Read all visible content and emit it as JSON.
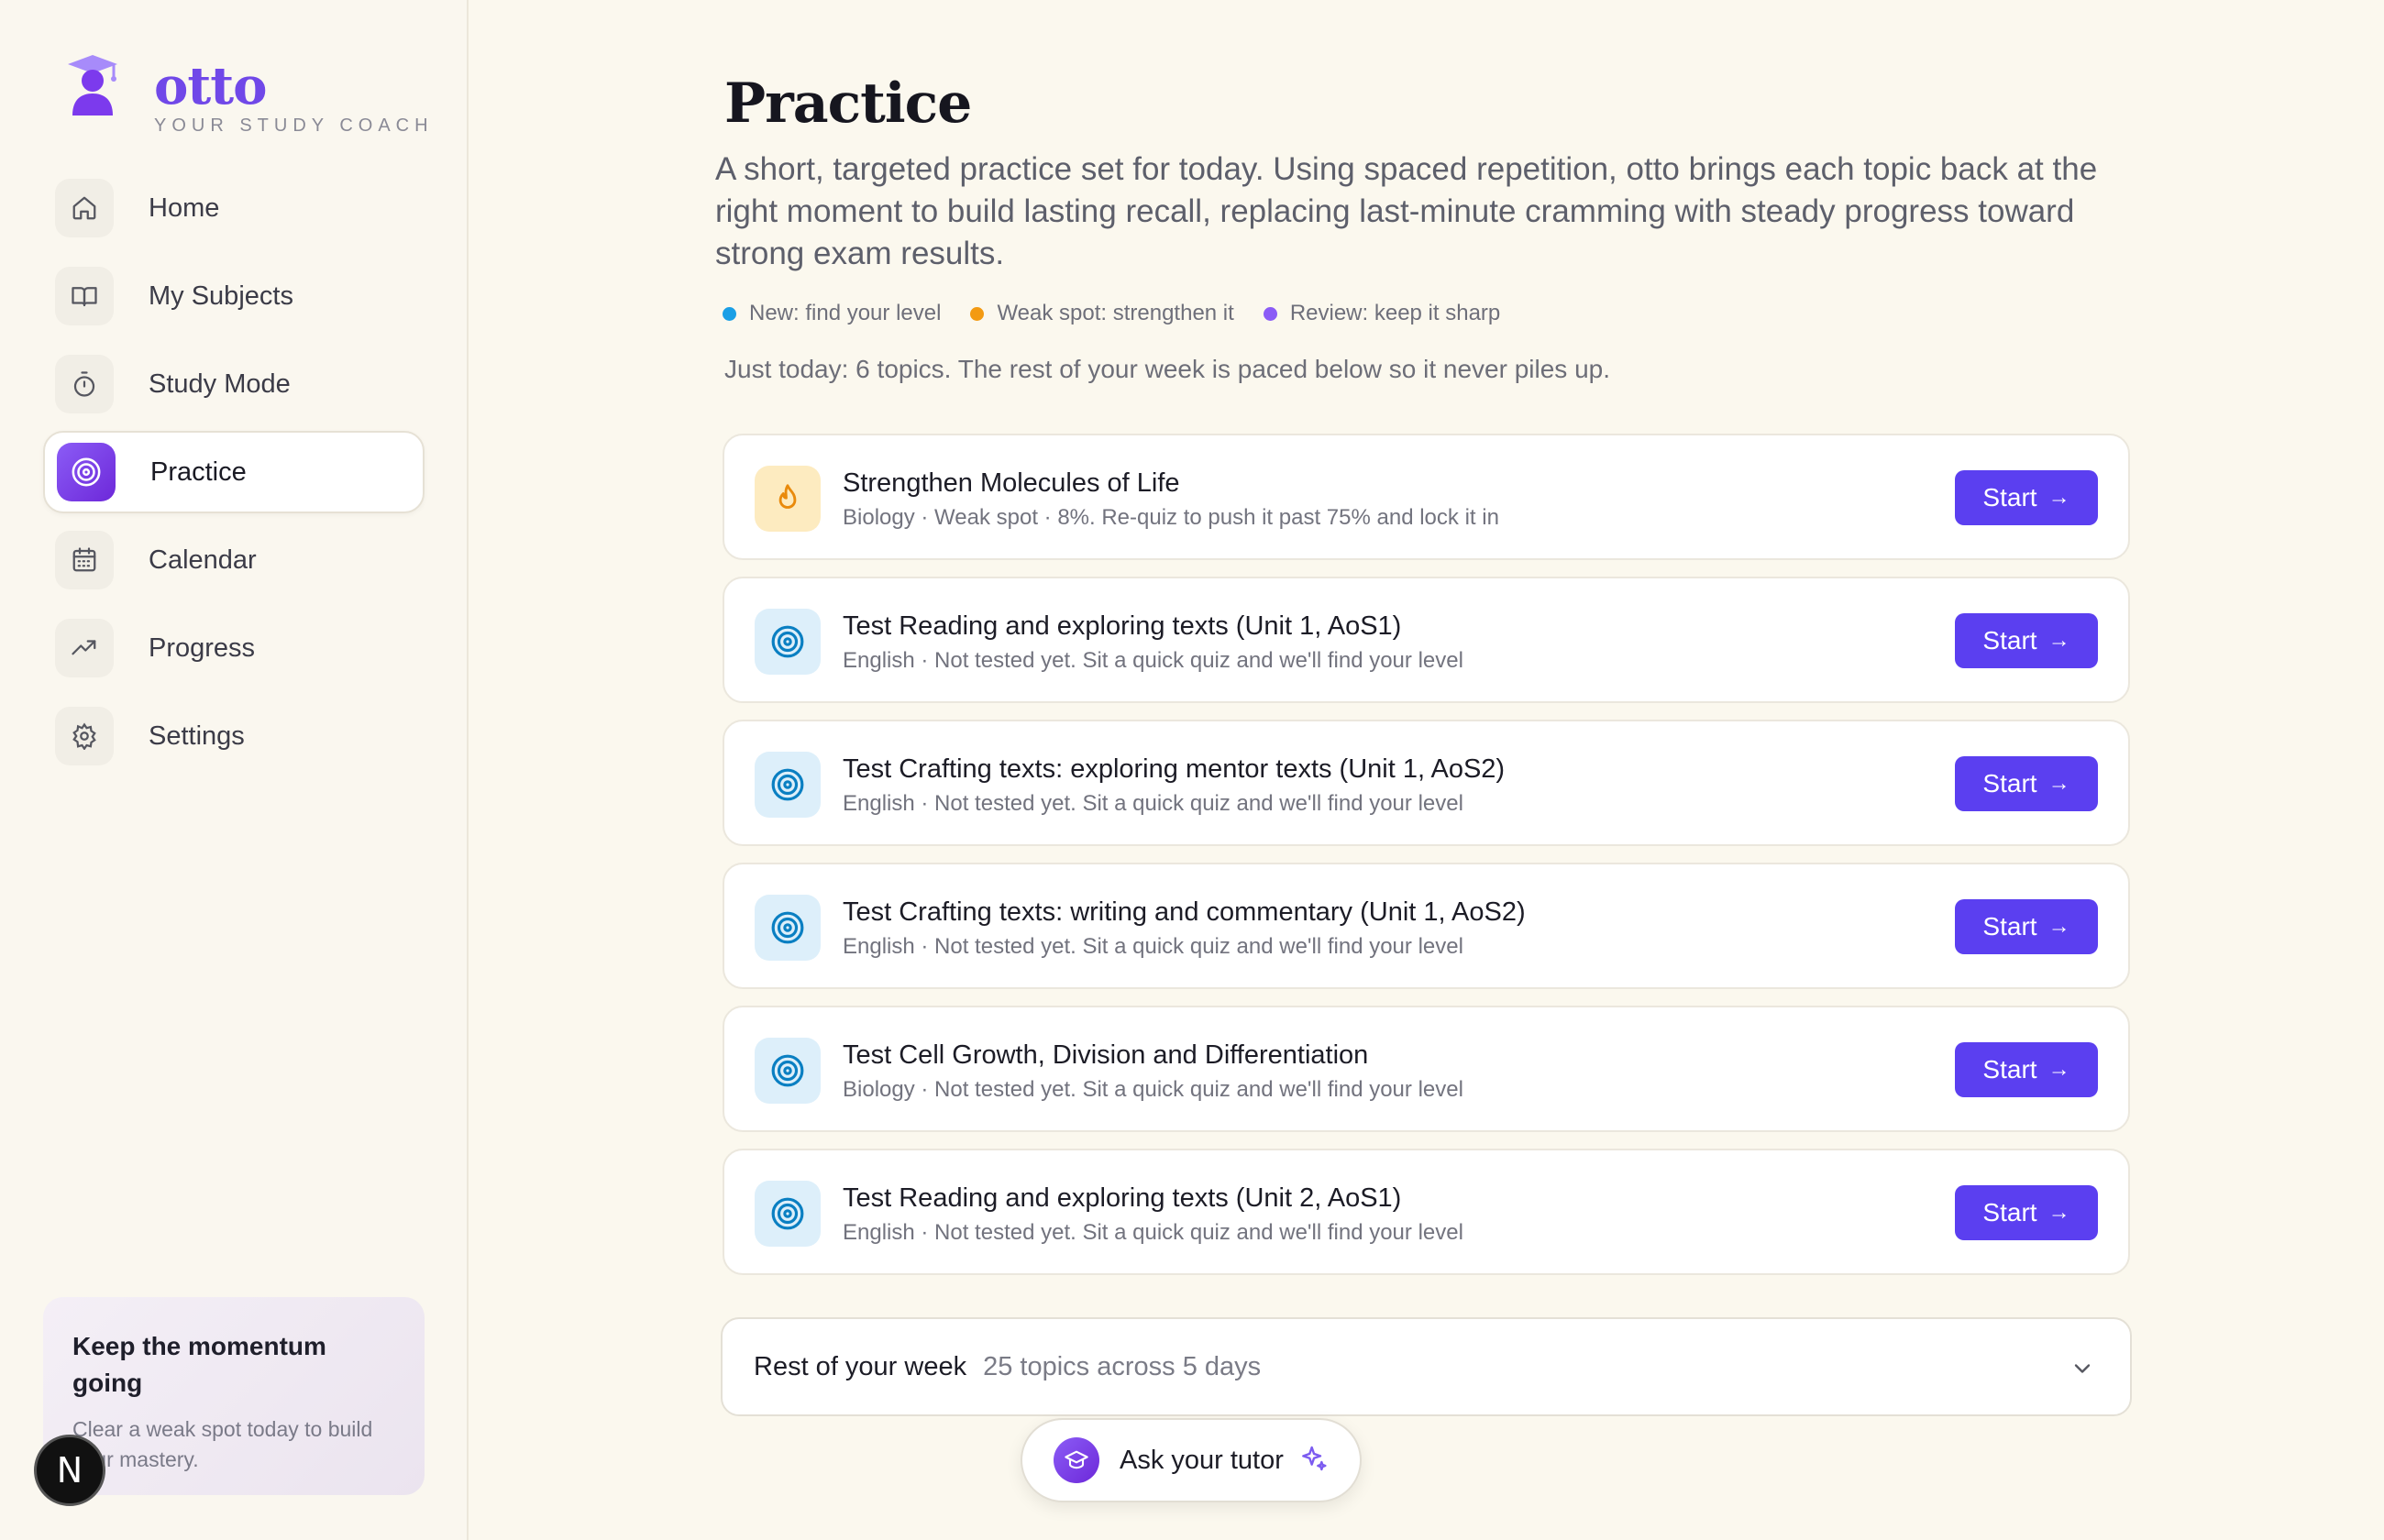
{
  "brand": {
    "name": "otto",
    "tagline": "YOUR STUDY COACH"
  },
  "nav": {
    "items": [
      {
        "label": "Home",
        "icon": "home-icon"
      },
      {
        "label": "My Subjects",
        "icon": "book-icon"
      },
      {
        "label": "Study Mode",
        "icon": "timer-icon"
      },
      {
        "label": "Practice",
        "icon": "target-icon",
        "active": true
      },
      {
        "label": "Calendar",
        "icon": "calendar-icon"
      },
      {
        "label": "Progress",
        "icon": "trend-icon"
      },
      {
        "label": "Settings",
        "icon": "gear-icon"
      }
    ]
  },
  "momentum": {
    "title": "Keep the momentum going",
    "body": "Clear a weak spot today to build your mastery."
  },
  "badge": {
    "letter": "N"
  },
  "page": {
    "title": "Practice",
    "subtitle": "A short, targeted practice set for today. Using spaced repetition, otto brings each topic back at the right moment to build lasting recall, replacing last-minute cramming with steady progress toward strong exam results.",
    "legend": [
      {
        "label": "New: find your level",
        "color": "#1a9fe6"
      },
      {
        "label": "Weak spot: strengthen it",
        "color": "#f39a12"
      },
      {
        "label": "Review: keep it sharp",
        "color": "#8b5cf6"
      }
    ],
    "today_note": "Just today: 6 topics. The rest of your week is paced below so it never piles up."
  },
  "tasks": [
    {
      "kind": "weak",
      "icon": "flame-icon",
      "title": "Strengthen Molecules of Life",
      "meta": "Biology · Weak spot · 8%. Re-quiz to push it past 75% and lock it in",
      "button": "Start"
    },
    {
      "kind": "new",
      "icon": "target-icon",
      "title": "Test Reading and exploring texts (Unit 1, AoS1)",
      "meta": "English · Not tested yet. Sit a quick quiz and we'll find your level",
      "button": "Start"
    },
    {
      "kind": "new",
      "icon": "target-icon",
      "title": "Test Crafting texts: exploring mentor texts (Unit 1, AoS2)",
      "meta": "English · Not tested yet. Sit a quick quiz and we'll find your level",
      "button": "Start"
    },
    {
      "kind": "new",
      "icon": "target-icon",
      "title": "Test Crafting texts: writing and commentary (Unit 1, AoS2)",
      "meta": "English · Not tested yet. Sit a quick quiz and we'll find your level",
      "button": "Start"
    },
    {
      "kind": "new",
      "icon": "target-icon",
      "title": "Test Cell Growth, Division and Differentiation",
      "meta": "Biology · Not tested yet. Sit a quick quiz and we'll find your level",
      "button": "Start"
    },
    {
      "kind": "new",
      "icon": "target-icon",
      "title": "Test Reading and exploring texts (Unit 2, AoS1)",
      "meta": "English · Not tested yet. Sit a quick quiz and we'll find your level",
      "button": "Start"
    }
  ],
  "week": {
    "title": "Rest of your week",
    "summary": "25 topics across 5 days"
  },
  "tutor": {
    "label": "Ask your tutor"
  },
  "colors": {
    "accent": "#5b3ff0",
    "brand": "#7048e8",
    "background": "#fbf8ee"
  }
}
